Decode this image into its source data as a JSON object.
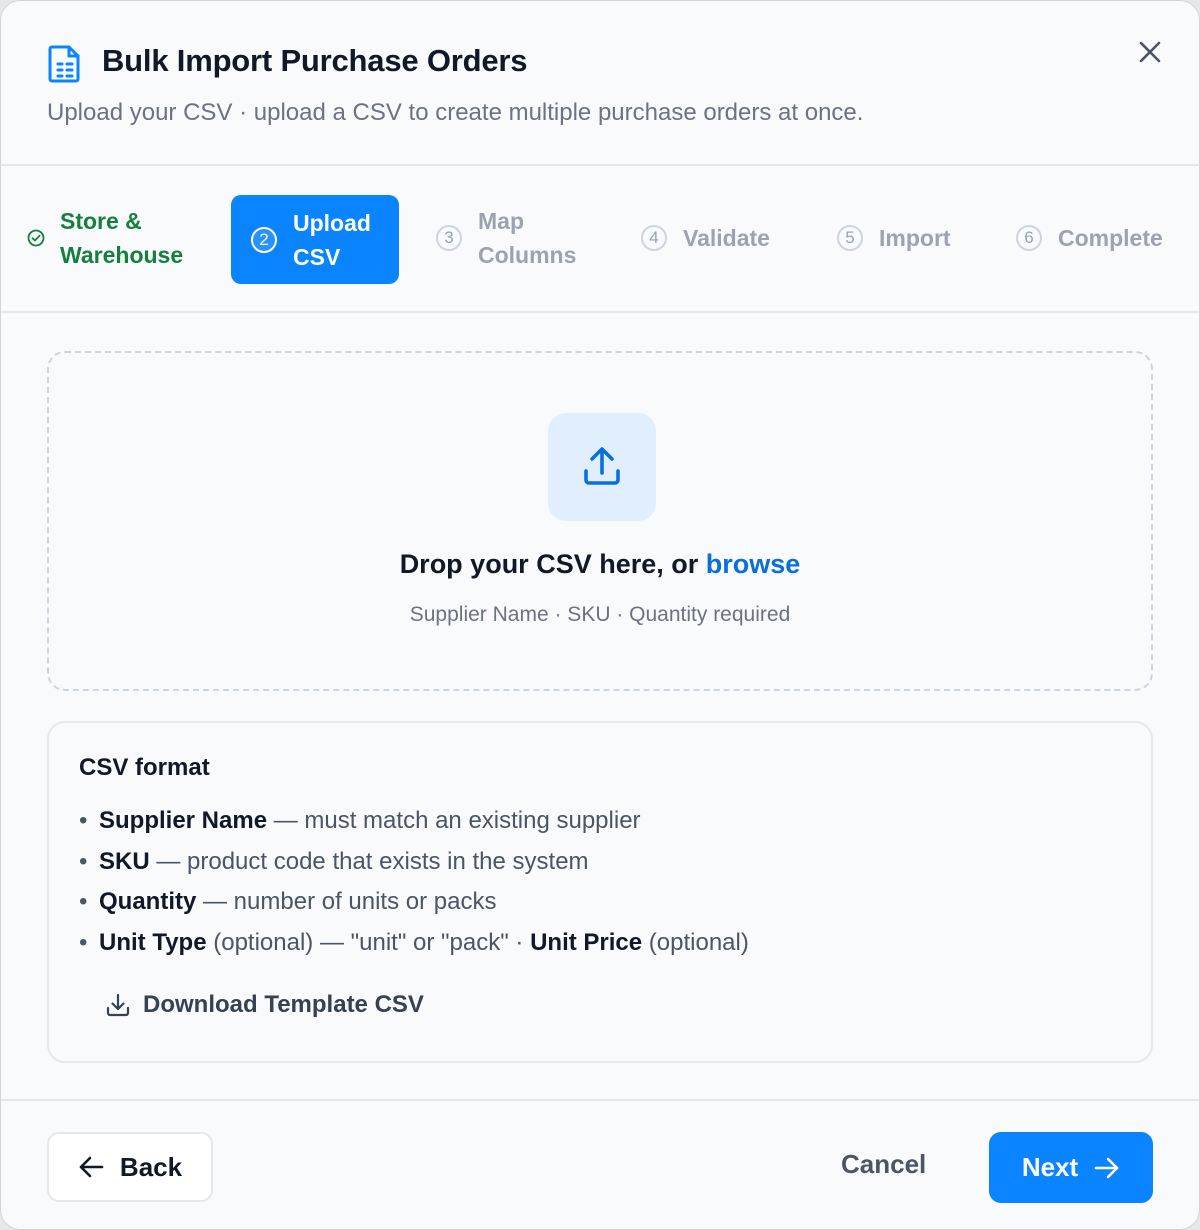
{
  "modal": {
    "title": "Bulk Import Purchase Orders",
    "subtitle": "Upload your CSV · upload a CSV to create multiple purchase orders at once.",
    "header_icon": "file-spreadsheet-icon",
    "close_icon": "close-icon"
  },
  "stepper": {
    "steps": [
      {
        "number": "1",
        "line1": "Store &",
        "line2": "Warehouse",
        "status": "done"
      },
      {
        "number": "2",
        "line1": "Upload",
        "line2": "CSV",
        "status": "active"
      },
      {
        "number": "3",
        "line1": "Map",
        "line2": "Columns",
        "status": "pending"
      },
      {
        "number": "4",
        "line1": "Validate",
        "line2": "",
        "status": "pending"
      },
      {
        "number": "5",
        "line1": "Import",
        "line2": "",
        "status": "pending"
      },
      {
        "number": "6",
        "line1": "Complete",
        "line2": "",
        "status": "pending"
      }
    ]
  },
  "dropzone": {
    "title_prefix": "Drop your CSV here, or",
    "browse_label": "browse",
    "hint": "Supplier Name · SKU · Quantity required",
    "icon": "upload-icon"
  },
  "format": {
    "title": "CSV format",
    "items": [
      {
        "bold": "Supplier Name",
        "rest": " — must match an existing supplier"
      },
      {
        "bold": "SKU",
        "rest": " — product code that exists in the system"
      },
      {
        "bold": "Quantity",
        "rest": " — number of units or packs"
      },
      {
        "bold": "Unit Type",
        "rest": " (optional) — \"unit\" or \"pack\" · ",
        "bold2": "Unit Price",
        "rest2": " (optional)"
      }
    ],
    "download_label": "Download Template CSV"
  },
  "footer": {
    "back_label": "Back",
    "cancel_label": "Cancel",
    "next_label": "Next"
  },
  "colors": {
    "primary": "#0a84ff",
    "success": "#15803d",
    "link": "#0a6fdc",
    "muted": "#9ca3af"
  }
}
